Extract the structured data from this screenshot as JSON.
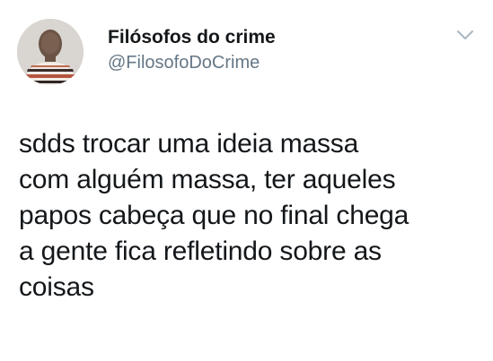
{
  "tweet": {
    "author": {
      "display_name": "Filósofos do crime",
      "handle": "@FilosofoDoCrime",
      "avatar_icon": "profile-photo"
    },
    "menu_icon": "chevron-down-icon",
    "text_lines": [
      "sdds trocar uma ideia massa",
      "com alguém massa, ter aqueles",
      "papos cabeça que no final chega",
      "a gente fica refletindo sobre as",
      "coisas"
    ]
  },
  "colors": {
    "text_primary": "#14171a",
    "text_secondary": "#657786",
    "chevron": "#aab8c2",
    "background": "#ffffff"
  }
}
